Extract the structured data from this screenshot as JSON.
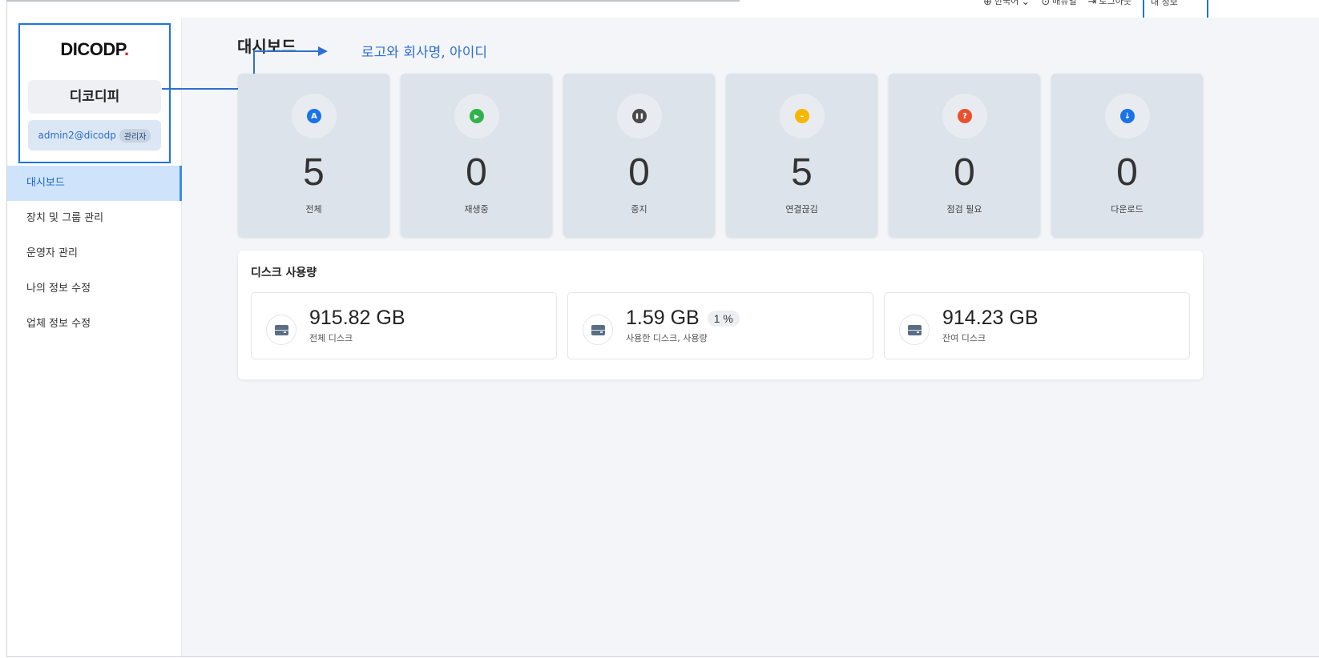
{
  "header": {
    "language": "한국어",
    "manual": "매뉴얼",
    "logout": "로그아웃",
    "highlighted": "내 정보"
  },
  "profile": {
    "logo_text": "DICODP",
    "logo_dot": ".",
    "company_name": "디코디피",
    "user_id": "admin2@dicodp",
    "role_badge": "관리자"
  },
  "sidebar": {
    "items": [
      {
        "label": "대시보드",
        "active": true
      },
      {
        "label": "장치 및 그룹 관리"
      },
      {
        "label": "운영자 관리"
      },
      {
        "label": "나의 정보 수정"
      },
      {
        "label": "업체 정보 수정"
      }
    ]
  },
  "main": {
    "title": "대시보드",
    "annotation": "로고와 회사명, 아이디",
    "stats": [
      {
        "value": "5",
        "label": "전체",
        "icon": "all-icon",
        "color": "#1a73e8",
        "glyph": "A"
      },
      {
        "value": "0",
        "label": "재생중",
        "icon": "play-icon",
        "color": "#2fb34a",
        "glyph": "▶"
      },
      {
        "value": "0",
        "label": "중지",
        "icon": "pause-icon",
        "color": "#4a4a4a",
        "glyph": "❚❚"
      },
      {
        "value": "5",
        "label": "연결끊김",
        "icon": "disconnected-icon",
        "color": "#f5b800",
        "glyph": "–"
      },
      {
        "value": "0",
        "label": "점검 필요",
        "icon": "question-icon",
        "color": "#e8512f",
        "glyph": "?"
      },
      {
        "value": "0",
        "label": "다운로드",
        "icon": "download-icon",
        "color": "#1a73e8",
        "glyph": "↓"
      }
    ],
    "disk": {
      "title": "디스크 사용량",
      "cards": [
        {
          "value": "915.82 GB",
          "label": "전체 디스크"
        },
        {
          "value": "1.59 GB",
          "percent": "1 %",
          "label": "사용한 디스크, 사용량"
        },
        {
          "value": "914.23 GB",
          "label": "잔여 디스크"
        }
      ]
    }
  }
}
